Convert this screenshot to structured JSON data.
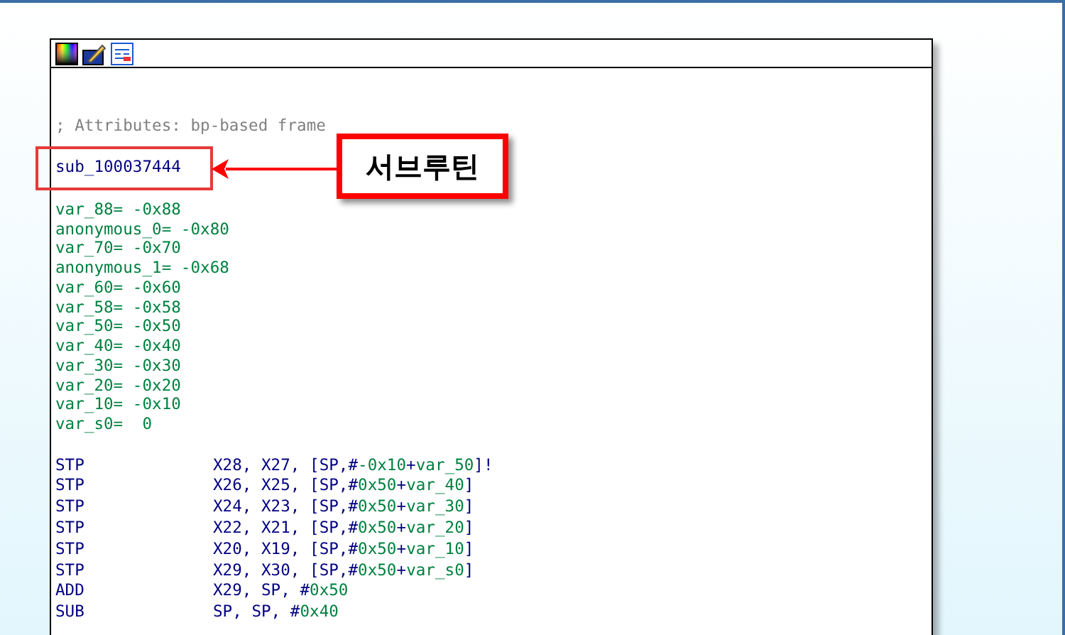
{
  "listing": {
    "comment": "; Attributes: bp-based frame",
    "label": "sub_100037444",
    "variables": [
      "var_88= -0x88",
      "anonymous_0= -0x80",
      "var_70= -0x70",
      "anonymous_1= -0x68",
      "var_60= -0x60",
      "var_58= -0x58",
      "var_50= -0x50",
      "var_40= -0x40",
      "var_30= -0x30",
      "var_20= -0x20",
      "var_10= -0x10",
      "var_s0=  0"
    ],
    "instructions": [
      {
        "mnemonic": "STP",
        "operands": [
          {
            "text": "X28, X27, [SP,#",
            "kind": "reg"
          },
          {
            "text": "-0x10",
            "kind": "num"
          },
          {
            "text": "+",
            "kind": "reg"
          },
          {
            "text": "var_50",
            "kind": "num"
          },
          {
            "text": "]!",
            "kind": "reg"
          }
        ]
      },
      {
        "mnemonic": "STP",
        "operands": [
          {
            "text": "X26, X25, [SP,#",
            "kind": "reg"
          },
          {
            "text": "0x50",
            "kind": "num"
          },
          {
            "text": "+",
            "kind": "reg"
          },
          {
            "text": "var_40",
            "kind": "num"
          },
          {
            "text": "]",
            "kind": "reg"
          }
        ]
      },
      {
        "mnemonic": "STP",
        "operands": [
          {
            "text": "X24, X23, [SP,#",
            "kind": "reg"
          },
          {
            "text": "0x50",
            "kind": "num"
          },
          {
            "text": "+",
            "kind": "reg"
          },
          {
            "text": "var_30",
            "kind": "num"
          },
          {
            "text": "]",
            "kind": "reg"
          }
        ]
      },
      {
        "mnemonic": "STP",
        "operands": [
          {
            "text": "X22, X21, [SP,#",
            "kind": "reg"
          },
          {
            "text": "0x50",
            "kind": "num"
          },
          {
            "text": "+",
            "kind": "reg"
          },
          {
            "text": "var_20",
            "kind": "num"
          },
          {
            "text": "]",
            "kind": "reg"
          }
        ]
      },
      {
        "mnemonic": "STP",
        "operands": [
          {
            "text": "X20, X19, [SP,#",
            "kind": "reg"
          },
          {
            "text": "0x50",
            "kind": "num"
          },
          {
            "text": "+",
            "kind": "reg"
          },
          {
            "text": "var_10",
            "kind": "num"
          },
          {
            "text": "]",
            "kind": "reg"
          }
        ]
      },
      {
        "mnemonic": "STP",
        "operands": [
          {
            "text": "X29, X30, [SP,#",
            "kind": "reg"
          },
          {
            "text": "0x50",
            "kind": "num"
          },
          {
            "text": "+",
            "kind": "reg"
          },
          {
            "text": "var_s0",
            "kind": "num"
          },
          {
            "text": "]",
            "kind": "reg"
          }
        ]
      },
      {
        "mnemonic": "ADD",
        "operands": [
          {
            "text": "X29, SP, #",
            "kind": "reg"
          },
          {
            "text": "0x50",
            "kind": "num"
          }
        ]
      },
      {
        "mnemonic": "SUB",
        "operands": [
          {
            "text": "SP, SP, #",
            "kind": "reg"
          },
          {
            "text": "0x40",
            "kind": "num"
          }
        ]
      }
    ]
  },
  "callout": {
    "text": "서브루틴"
  }
}
